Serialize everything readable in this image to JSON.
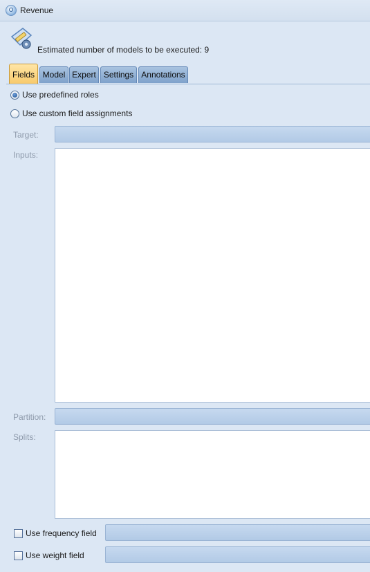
{
  "window": {
    "title": "Revenue"
  },
  "header": {
    "estimate_text": "Estimated number of models to be executed: 9"
  },
  "tabs": [
    {
      "label": "Fields",
      "active": true
    },
    {
      "label": "Model",
      "active": false
    },
    {
      "label": "Expert",
      "active": false
    },
    {
      "label": "Settings",
      "active": false
    },
    {
      "label": "Annotations",
      "active": false
    }
  ],
  "fields": {
    "role_options": [
      {
        "label": "Use predefined roles",
        "checked": true
      },
      {
        "label": "Use custom field assignments",
        "checked": false
      }
    ],
    "target": {
      "label": "Target:",
      "value": ""
    },
    "inputs": {
      "label": "Inputs:",
      "items": []
    },
    "partition": {
      "label": "Partition:",
      "value": ""
    },
    "splits": {
      "label": "Splits:",
      "items": []
    },
    "frequency": {
      "label": "Use frequency field",
      "checked": false,
      "value": ""
    },
    "weight": {
      "label": "Use weight field",
      "checked": false,
      "value": ""
    }
  },
  "colors": {
    "active_tab": "#f7c96a",
    "inactive_tab": "#8fb0d6",
    "panel": "#dce7f4"
  }
}
